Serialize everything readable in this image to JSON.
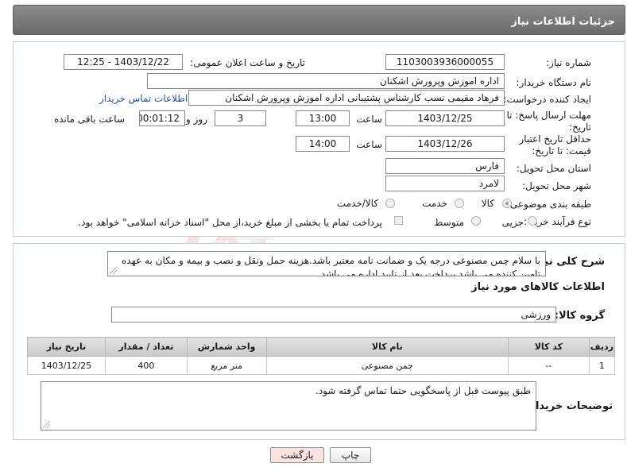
{
  "header": {
    "title": "جزئیات اطلاعات نیاز"
  },
  "form": {
    "need_number": {
      "label": "شماره نیاز:",
      "value": "1103003936000055"
    },
    "announce_datetime": {
      "label": "تاریخ و ساعت اعلان عمومی:",
      "value": "1403/12/22 - 12:25"
    },
    "buyer_org": {
      "label": "نام دستگاه خریدار:",
      "value": "اداره اموزش وپرورش اشکنان"
    },
    "requester": {
      "label": "ایجاد کننده درخواست:",
      "value": "فرهاد مقیمی نسب کارشناس پشتیبانی اداره اموزش وپرورش اشکنان",
      "contact_link": "اطلاعات تماس خریدار"
    },
    "reply_deadline": {
      "label": "مهلت ارسال پاسخ: تا تاریخ:",
      "date": "1403/12/25",
      "time_label": "ساعت",
      "time": "13:00",
      "days": "3",
      "days_label": "روز و",
      "remaining": "00:01:12",
      "remaining_label": "ساعت باقی مانده"
    },
    "price_validity": {
      "label": "حداقل تاریخ اعتبار قیمت: تا تاریخ:",
      "date": "1403/12/26",
      "time_label": "ساعت",
      "time": "14:00"
    },
    "province": {
      "label": "استان محل تحویل:",
      "value": "فارس"
    },
    "city": {
      "label": "شهر محل تحویل:",
      "value": "لامرد"
    },
    "category": {
      "label": "طبقه بندی موضوعی:",
      "options": [
        "کالا",
        "خدمت",
        "کالا/خدمت"
      ],
      "selected": "کالا"
    },
    "process_type": {
      "label": "نوع فرآیند خرید :",
      "options": [
        "جزیی",
        "متوسط"
      ],
      "checkbox_label": "پرداخت تمام یا بخشی از مبلغ خرید،از محل \"اسناد خزانه اسلامی\" خواهد بود."
    }
  },
  "description": {
    "label": "شرح کلی نیاز:",
    "text": "با سلام چمن مصنوعی درجه یک و ضمانت نامه معتبر باشد.هزینه حمل ونقل و نصب و بیمه و مکان به عهده تامین کننده می باشد پرداخت بعد از تایید اداره می باشد."
  },
  "goods": {
    "section_title": "اطلاعات کالاهای مورد نیاز",
    "group_label": "گروه کالا:",
    "group_value": "ورزشی",
    "columns": [
      "ردیف",
      "کد کالا",
      "نام کالا",
      "واحد شمارش",
      "تعداد / مقدار",
      "تاریخ نیاز"
    ],
    "rows": [
      {
        "index": "1",
        "code": "--",
        "name": "چمن مصنوعی",
        "unit": "متر مربع",
        "qty": "400",
        "date": "1403/12/25"
      }
    ]
  },
  "buyer_notes": {
    "label": "توضیحات خریدار:",
    "text": "طبق پیوست قبل از پاسخگویی حتما تماس گرفته شود."
  },
  "buttons": {
    "print": "چاپ",
    "back": "بازگشت"
  },
  "watermark": {
    "text": "AriaTender.neT"
  },
  "colors": {
    "header": "#7a7a7a",
    "link": "#1c4fb3",
    "back_button": "#f8e2e2"
  }
}
